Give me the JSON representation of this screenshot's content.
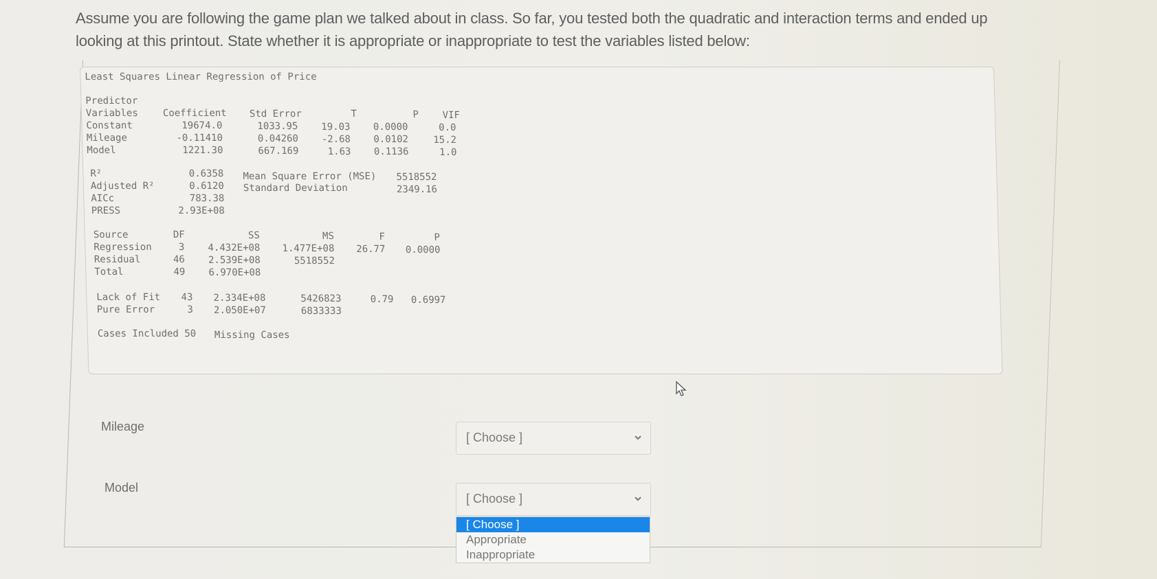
{
  "question": {
    "line1": "Assume you are following the game plan we talked about in class. So far, you tested both the quadratic and interaction terms and ended up",
    "line2": "looking at this printout. State whether it is appropriate or inappropriate to test the variables listed below:"
  },
  "printout": {
    "title": "Least Squares Linear Regression of Price",
    "coef_table": {
      "headers": {
        "predictor_line1": "Predictor",
        "predictor_line2": "Variables",
        "coefficient": "Coefficient",
        "std_error": "Std Error",
        "t": "T",
        "p": "P",
        "vif": "VIF"
      },
      "rows": [
        {
          "name": "Constant",
          "coefficient": "19674.0",
          "std_error": "1033.95",
          "t": "19.03",
          "p": "0.0000",
          "vif": "0.0"
        },
        {
          "name": "Mileage",
          "coefficient": "-0.11410",
          "std_error": "0.04260",
          "t": "-2.68",
          "p": "0.0102",
          "vif": "15.2"
        },
        {
          "name": "Model",
          "coefficient": "1221.30",
          "std_error": "667.169",
          "t": "1.63",
          "p": "0.1136",
          "vif": "1.0"
        }
      ]
    },
    "fit_stats": {
      "r2_label": "R²",
      "r2": "0.6358",
      "adj_r2_label": "Adjusted R²",
      "adj_r2": "0.6120",
      "aicc_label": "AICc",
      "aicc": "783.38",
      "press_label": "PRESS",
      "press": "2.93E+08",
      "mse_label": "Mean Square Error (MSE)",
      "mse": "5518552",
      "sd_label": "Standard Deviation",
      "sd": "2349.16"
    },
    "anova": {
      "headers": {
        "source": "Source",
        "df": "DF",
        "ss": "SS",
        "ms": "MS",
        "f": "F",
        "p": "P"
      },
      "rows": [
        {
          "source": "Regression",
          "df": "3",
          "ss": "4.432E+08",
          "ms": "1.477E+08",
          "f": "26.77",
          "p": "0.0000"
        },
        {
          "source": "Residual",
          "df": "46",
          "ss": "2.539E+08",
          "ms": "5518552",
          "f": "",
          "p": ""
        },
        {
          "source": "Total",
          "df": "49",
          "ss": "6.970E+08",
          "ms": "",
          "f": "",
          "p": ""
        }
      ]
    },
    "lack_of_fit": {
      "rows": [
        {
          "source": "Lack of Fit",
          "df": "43",
          "ss": "2.334E+08",
          "ms": "5426823",
          "f": "0.79",
          "p": "0.6997"
        },
        {
          "source": "Pure Error",
          "df": "3",
          "ss": "2.050E+07",
          "ms": "6833333",
          "f": "",
          "p": ""
        }
      ]
    },
    "cases_included": "Cases Included 50",
    "missing_cases": "Missing Cases"
  },
  "fields": [
    {
      "label": "Mileage",
      "selected": "[ Choose ]",
      "open": false
    },
    {
      "label": "Model",
      "selected": "[ Choose ]",
      "open": true
    }
  ],
  "dropdown_options": [
    "[ Choose ]",
    "Appropriate",
    "Inappropriate"
  ],
  "colors": {
    "highlight": "#1a86e8",
    "background": "#eeede9"
  }
}
